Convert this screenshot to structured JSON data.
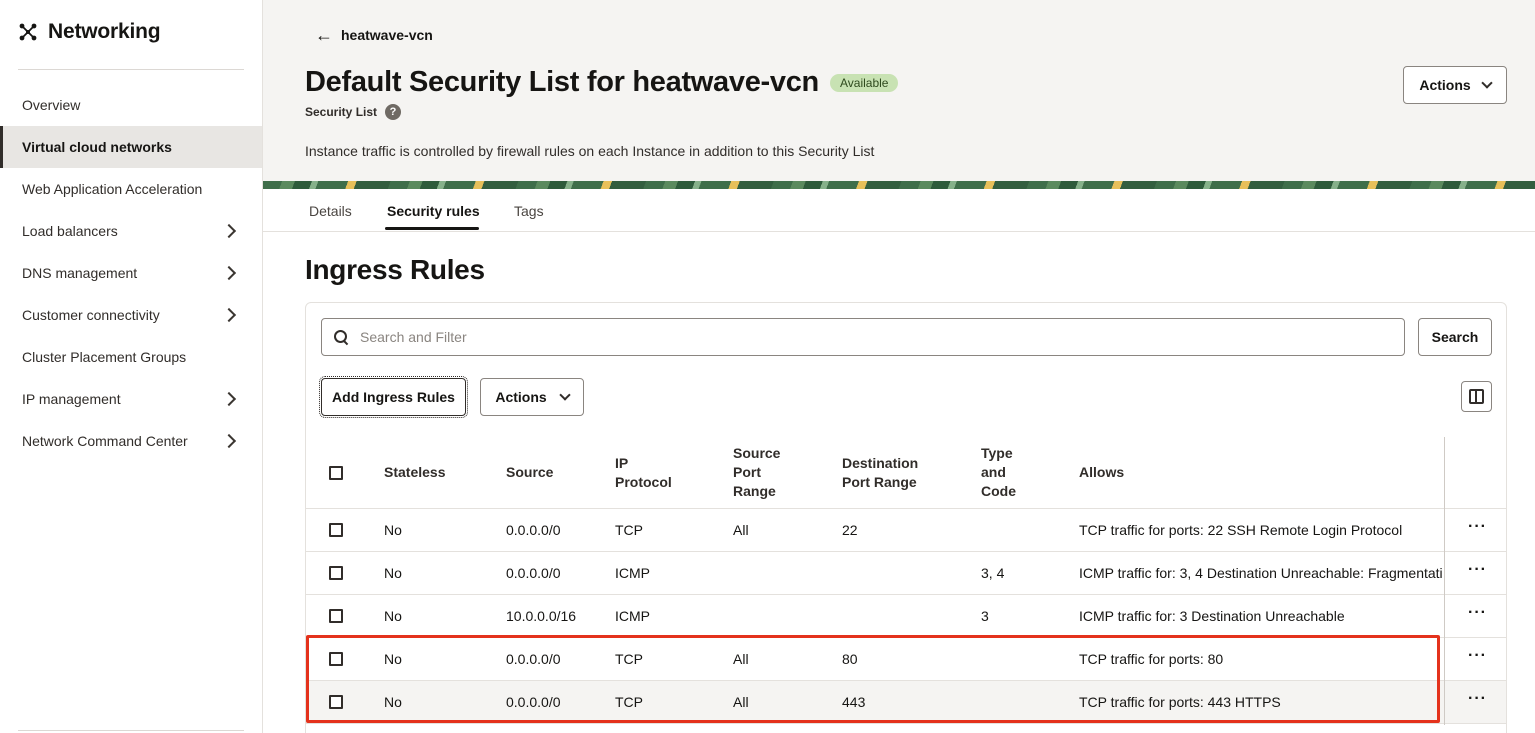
{
  "sidebar": {
    "title": "Networking",
    "items": [
      {
        "label": "Overview"
      },
      {
        "label": "Virtual cloud networks"
      },
      {
        "label": "Web Application Acceleration"
      },
      {
        "label": "Load balancers"
      },
      {
        "label": "DNS management"
      },
      {
        "label": "Customer connectivity"
      },
      {
        "label": "Cluster Placement Groups"
      },
      {
        "label": "IP management"
      },
      {
        "label": "Network Command Center"
      }
    ]
  },
  "header": {
    "back_label": "heatwave-vcn",
    "title": "Default Security List for heatwave-vcn",
    "status": "Available",
    "subtitle": "Security List",
    "help_glyph": "?",
    "description": "Instance traffic is controlled by firewall rules on each Instance in addition to this Security List",
    "actions_label": "Actions"
  },
  "tabs": [
    {
      "label": "Details"
    },
    {
      "label": "Security rules"
    },
    {
      "label": "Tags"
    }
  ],
  "section_title": "Ingress Rules",
  "toolbar": {
    "search_placeholder": "Search and Filter",
    "search_button": "Search",
    "add_button": "Add Ingress Rules",
    "actions_label": "Actions"
  },
  "table": {
    "headers": {
      "stateless": "Stateless",
      "source": "Source",
      "ip_protocol": [
        "IP",
        "Protocol"
      ],
      "source_port_range": [
        "Source",
        "Port",
        "Range"
      ],
      "dest_port_range": [
        "Destination",
        "Port Range"
      ],
      "type_code": [
        "Type",
        "and",
        "Code"
      ],
      "allows": "Allows"
    },
    "rows": [
      {
        "stateless": "No",
        "source": "0.0.0.0/0",
        "protocol": "TCP",
        "src_port": "All",
        "dst_port": "22",
        "type_code": "",
        "allows": "TCP traffic for ports: 22 SSH Remote Login Protocol"
      },
      {
        "stateless": "No",
        "source": "0.0.0.0/0",
        "protocol": "ICMP",
        "src_port": "",
        "dst_port": "",
        "type_code": "3, 4",
        "allows": "ICMP traffic for: 3, 4 Destination Unreachable: Fragmentati"
      },
      {
        "stateless": "No",
        "source": "10.0.0.0/16",
        "protocol": "ICMP",
        "src_port": "",
        "dst_port": "",
        "type_code": "3",
        "allows": "ICMP traffic for: 3 Destination Unreachable"
      },
      {
        "stateless": "No",
        "source": "0.0.0.0/0",
        "protocol": "TCP",
        "src_port": "All",
        "dst_port": "80",
        "type_code": "",
        "allows": "TCP traffic for ports: 80"
      },
      {
        "stateless": "No",
        "source": "0.0.0.0/0",
        "protocol": "TCP",
        "src_port": "All",
        "dst_port": "443",
        "type_code": "",
        "allows": "TCP traffic for ports: 443 HTTPS"
      }
    ],
    "kebab_glyph": "···"
  },
  "colors": {
    "badge_bg": "#c8e2b3",
    "highlight": "#e4321c",
    "header_bg": "#f5f4f2"
  }
}
